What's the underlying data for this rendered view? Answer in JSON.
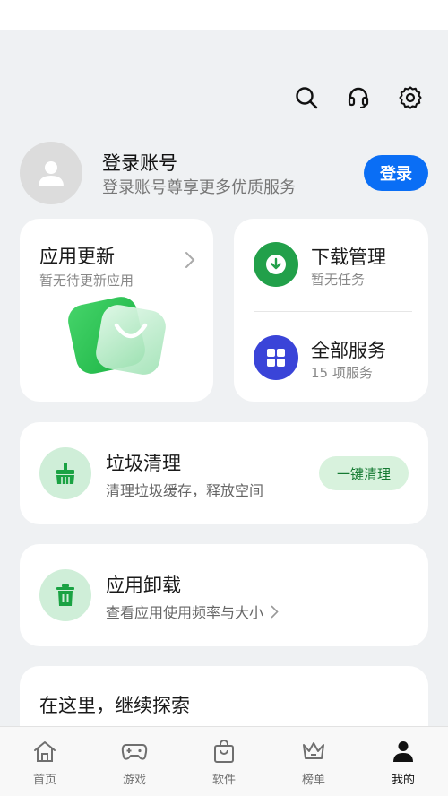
{
  "header": {
    "icons": [
      "search-icon",
      "headset-icon",
      "settings-icon"
    ]
  },
  "profile": {
    "title": "登录账号",
    "subtitle": "登录账号尊享更多优质服务",
    "login_label": "登录",
    "accent": "#0a6ef5"
  },
  "update_card": {
    "title": "应用更新",
    "subtitle": "暂无待更新应用"
  },
  "download_card": {
    "title": "下载管理",
    "subtitle": "暂无任务",
    "color": "#22a04a"
  },
  "services_card": {
    "title": "全部服务",
    "subtitle": "15 项服务",
    "color": "#3a44d8"
  },
  "cleanup_card": {
    "title": "垃圾清理",
    "subtitle": "清理垃圾缓存，释放空间",
    "action_label": "一键清理"
  },
  "uninstall_card": {
    "title": "应用卸载",
    "subtitle": "查看应用使用频率与大小"
  },
  "explore": {
    "title": "在这里，继续探索"
  },
  "tabbar": {
    "tabs": [
      {
        "label": "首页",
        "icon": "home-icon"
      },
      {
        "label": "游戏",
        "icon": "gamepad-icon"
      },
      {
        "label": "软件",
        "icon": "shopping-bag-icon"
      },
      {
        "label": "榜单",
        "icon": "crown-icon"
      },
      {
        "label": "我的",
        "icon": "person-icon",
        "active": true
      }
    ]
  }
}
